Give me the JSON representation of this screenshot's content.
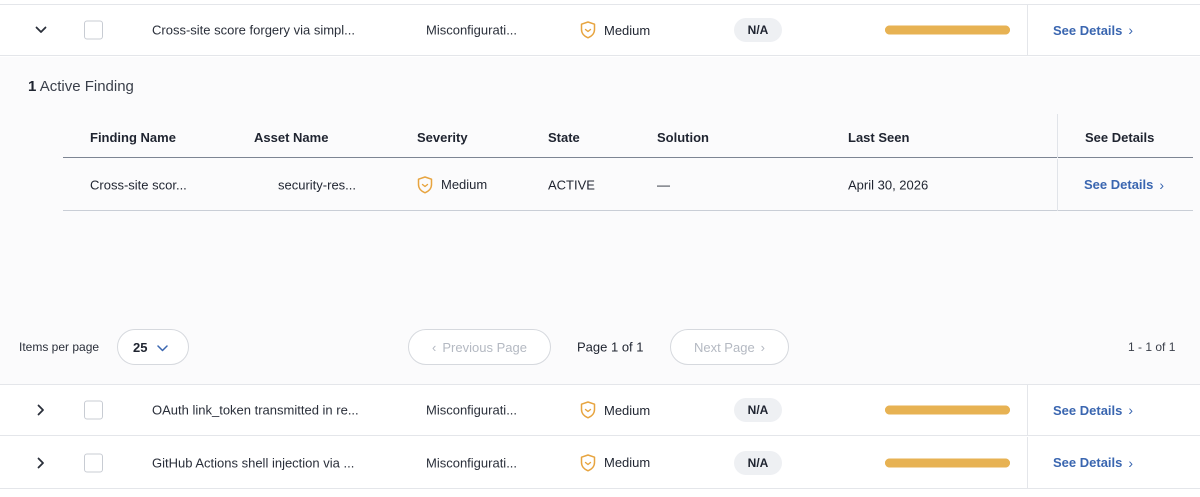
{
  "rows": [
    {
      "expanded": true,
      "title": "Cross-site score forgery via simpl...",
      "category": "Misconfigurati...",
      "severity": "Medium",
      "badge": "N/A",
      "progress": 1.0,
      "link": "See Details"
    },
    {
      "expanded": false,
      "title": "OAuth link_token transmitted in re...",
      "category": "Misconfigurati...",
      "severity": "Medium",
      "badge": "N/A",
      "progress": 1.0,
      "link": "See Details"
    },
    {
      "expanded": false,
      "title": "GitHub Actions shell injection via ...",
      "category": "Misconfigurati...",
      "severity": "Medium",
      "badge": "N/A",
      "progress": 1.0,
      "link": "See Details"
    }
  ],
  "expanded_panel": {
    "count": "1",
    "title_suffix": "Active Finding",
    "columns": [
      "Finding Name",
      "Asset Name",
      "Severity",
      "State",
      "Solution",
      "Last Seen",
      "See Details"
    ],
    "finding": {
      "name": "Cross-site scor...",
      "asset": "security-res...",
      "severity": "Medium",
      "state": "ACTIVE",
      "solution": "—",
      "last_seen": "April 30, 2026",
      "link": "See Details"
    }
  },
  "pagination": {
    "items_per_page_label": "Items per page",
    "items_per_page": "25",
    "prev_label": "Previous Page",
    "next_label": "Next Page",
    "page_info": "Page 1 of 1",
    "range": "1 - 1 of 1"
  },
  "colors": {
    "severity_medium": "#e7a43f",
    "progress": "#e7b253",
    "link": "#3a66b0"
  }
}
